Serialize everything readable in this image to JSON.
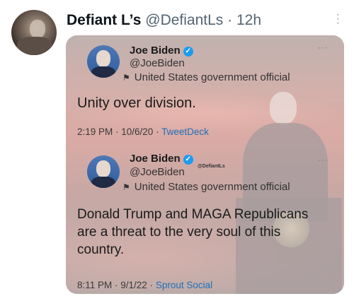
{
  "author": {
    "name": "Defiant L’s",
    "handle": "@DefiantLs",
    "separator": "·",
    "time": "12h"
  },
  "more_icon": "vertical-ellipsis",
  "quoted": [
    {
      "name": "Joe Biden",
      "handle": "@JoeBiden",
      "label": "United States government official",
      "text": "Unity over division.",
      "timestamp": "2:19 PM · 10/6/20 · ",
      "source": "TweetDeck"
    },
    {
      "name": "Joe Biden",
      "handle": "@JoeBiden",
      "label": "United States government official",
      "text_lines": [
        "Donald Trump and MAGA Republicans",
        "are a threat to the very soul of this",
        "country."
      ],
      "timestamp": "8:11 PM · 9/1/22 · ",
      "source": "Sprout Social"
    }
  ],
  "watermark": "@DefiantLs",
  "colors": {
    "verified": "#1d9bf0",
    "link": "#1d70b8"
  }
}
